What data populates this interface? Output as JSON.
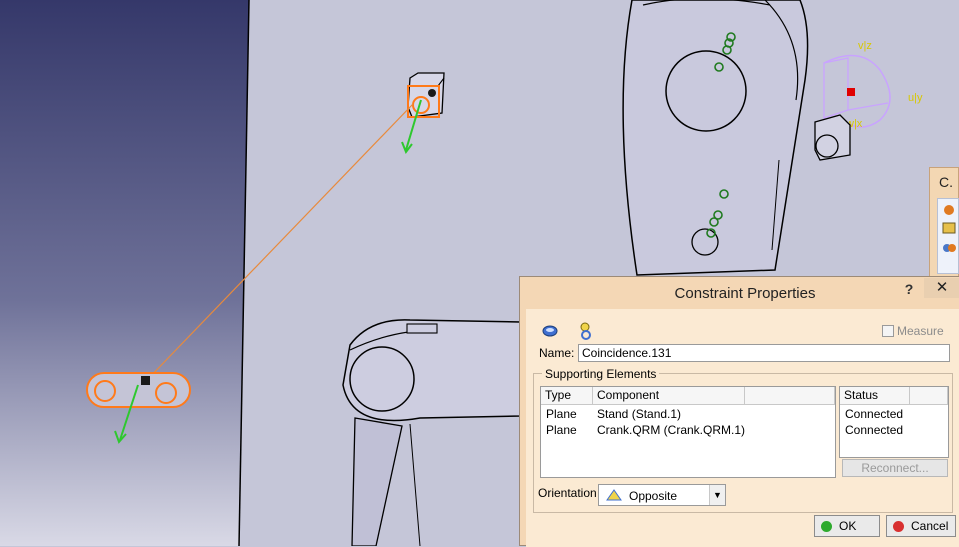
{
  "viewport": {
    "axis_labels": {
      "v_z": "v|z",
      "u_y": "u|y",
      "w_x": "w|x"
    }
  },
  "side_toolbar": {
    "title": "C."
  },
  "dialog": {
    "title": "Constraint Properties",
    "help_label": "?",
    "close_label": "✕",
    "measure_label": "Measure",
    "name_label": "Name:",
    "name_value": "Coincidence.131",
    "group_title": "Supporting Elements",
    "columns": {
      "type": "Type",
      "component": "Component",
      "status": "Status"
    },
    "rows": [
      {
        "type": "Plane",
        "component": "Stand (Stand.1)",
        "status": "Connected"
      },
      {
        "type": "Plane",
        "component": "Crank.QRM (Crank.QRM.1)",
        "status": "Connected"
      }
    ],
    "reconnect_label": "Reconnect...",
    "orientation_label": "Orientation",
    "orientation_value": "Opposite",
    "ok_label": "OK",
    "cancel_label": "Cancel"
  }
}
